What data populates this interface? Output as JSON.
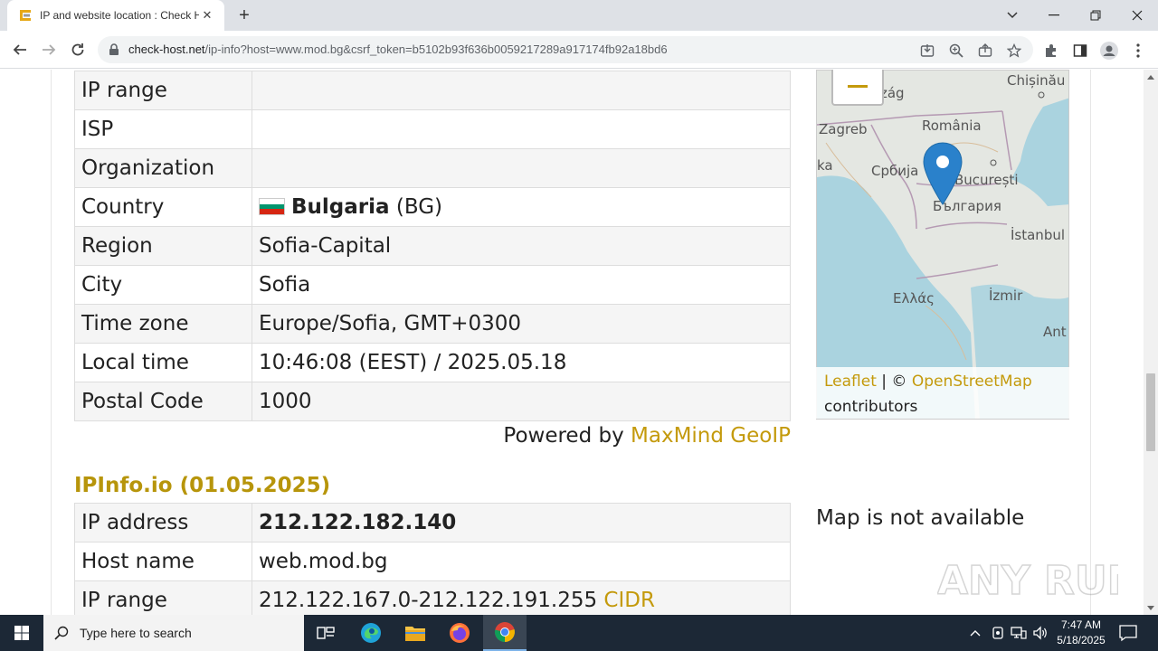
{
  "browser": {
    "tab_title": "IP and website location : Check Host",
    "tab_close": "✕",
    "new_tab": "+",
    "url_host": "check-host.net",
    "url_path": "/ip-info?host=www.mod.bg&csrf_token=b5102b93f636b0059217289a917174fb92a18bd6"
  },
  "geoip_table": {
    "rows": [
      {
        "key": "IP range",
        "value": ""
      },
      {
        "key": "ISP",
        "value": ""
      },
      {
        "key": "Organization",
        "value": ""
      },
      {
        "key": "Country",
        "value": "Bulgaria",
        "suffix": "(BG)"
      },
      {
        "key": "Region",
        "value": "Sofia-Capital"
      },
      {
        "key": "City",
        "value": "Sofia"
      },
      {
        "key": "Time zone",
        "value": "Europe/Sofia, GMT+0300"
      },
      {
        "key": "Local time",
        "value": "10:46:08 (EEST) / 2025.05.18"
      },
      {
        "key": "Postal Code",
        "value": "1000"
      }
    ],
    "powered_prefix": "Powered by",
    "powered_link": "MaxMind GeoIP"
  },
  "map": {
    "labels": [
      "Chișinău",
      "Zagreb",
      "România",
      "Србија",
      "București",
      "България",
      "İstanbul",
      "Ελλάς",
      "İzmir",
      "Ant",
      "rszág",
      "ka"
    ],
    "attribution_leaflet": "Leaflet",
    "attribution_sep": "| ©",
    "attribution_osm": "OpenStreetMap",
    "attribution_contrib": "contributors"
  },
  "ipinfo": {
    "title": "IPInfo.io (01.05.2025)",
    "rows": [
      {
        "key": "IP address",
        "value": "212.122.182.140"
      },
      {
        "key": "Host name",
        "value": "web.mod.bg"
      },
      {
        "key": "IP range",
        "value": "212.122.167.0-212.122.191.255",
        "link": "CIDR"
      }
    ],
    "map_unavailable": "Map is not available"
  },
  "watermark": "ANY RUN",
  "taskbar": {
    "search_placeholder": "Type here to search",
    "time": "7:47 AM",
    "date": "5/18/2025"
  },
  "colors": {
    "link_gold": "#c49a0c",
    "section_gold": "#b7950b",
    "taskbar": "#1c2836"
  }
}
